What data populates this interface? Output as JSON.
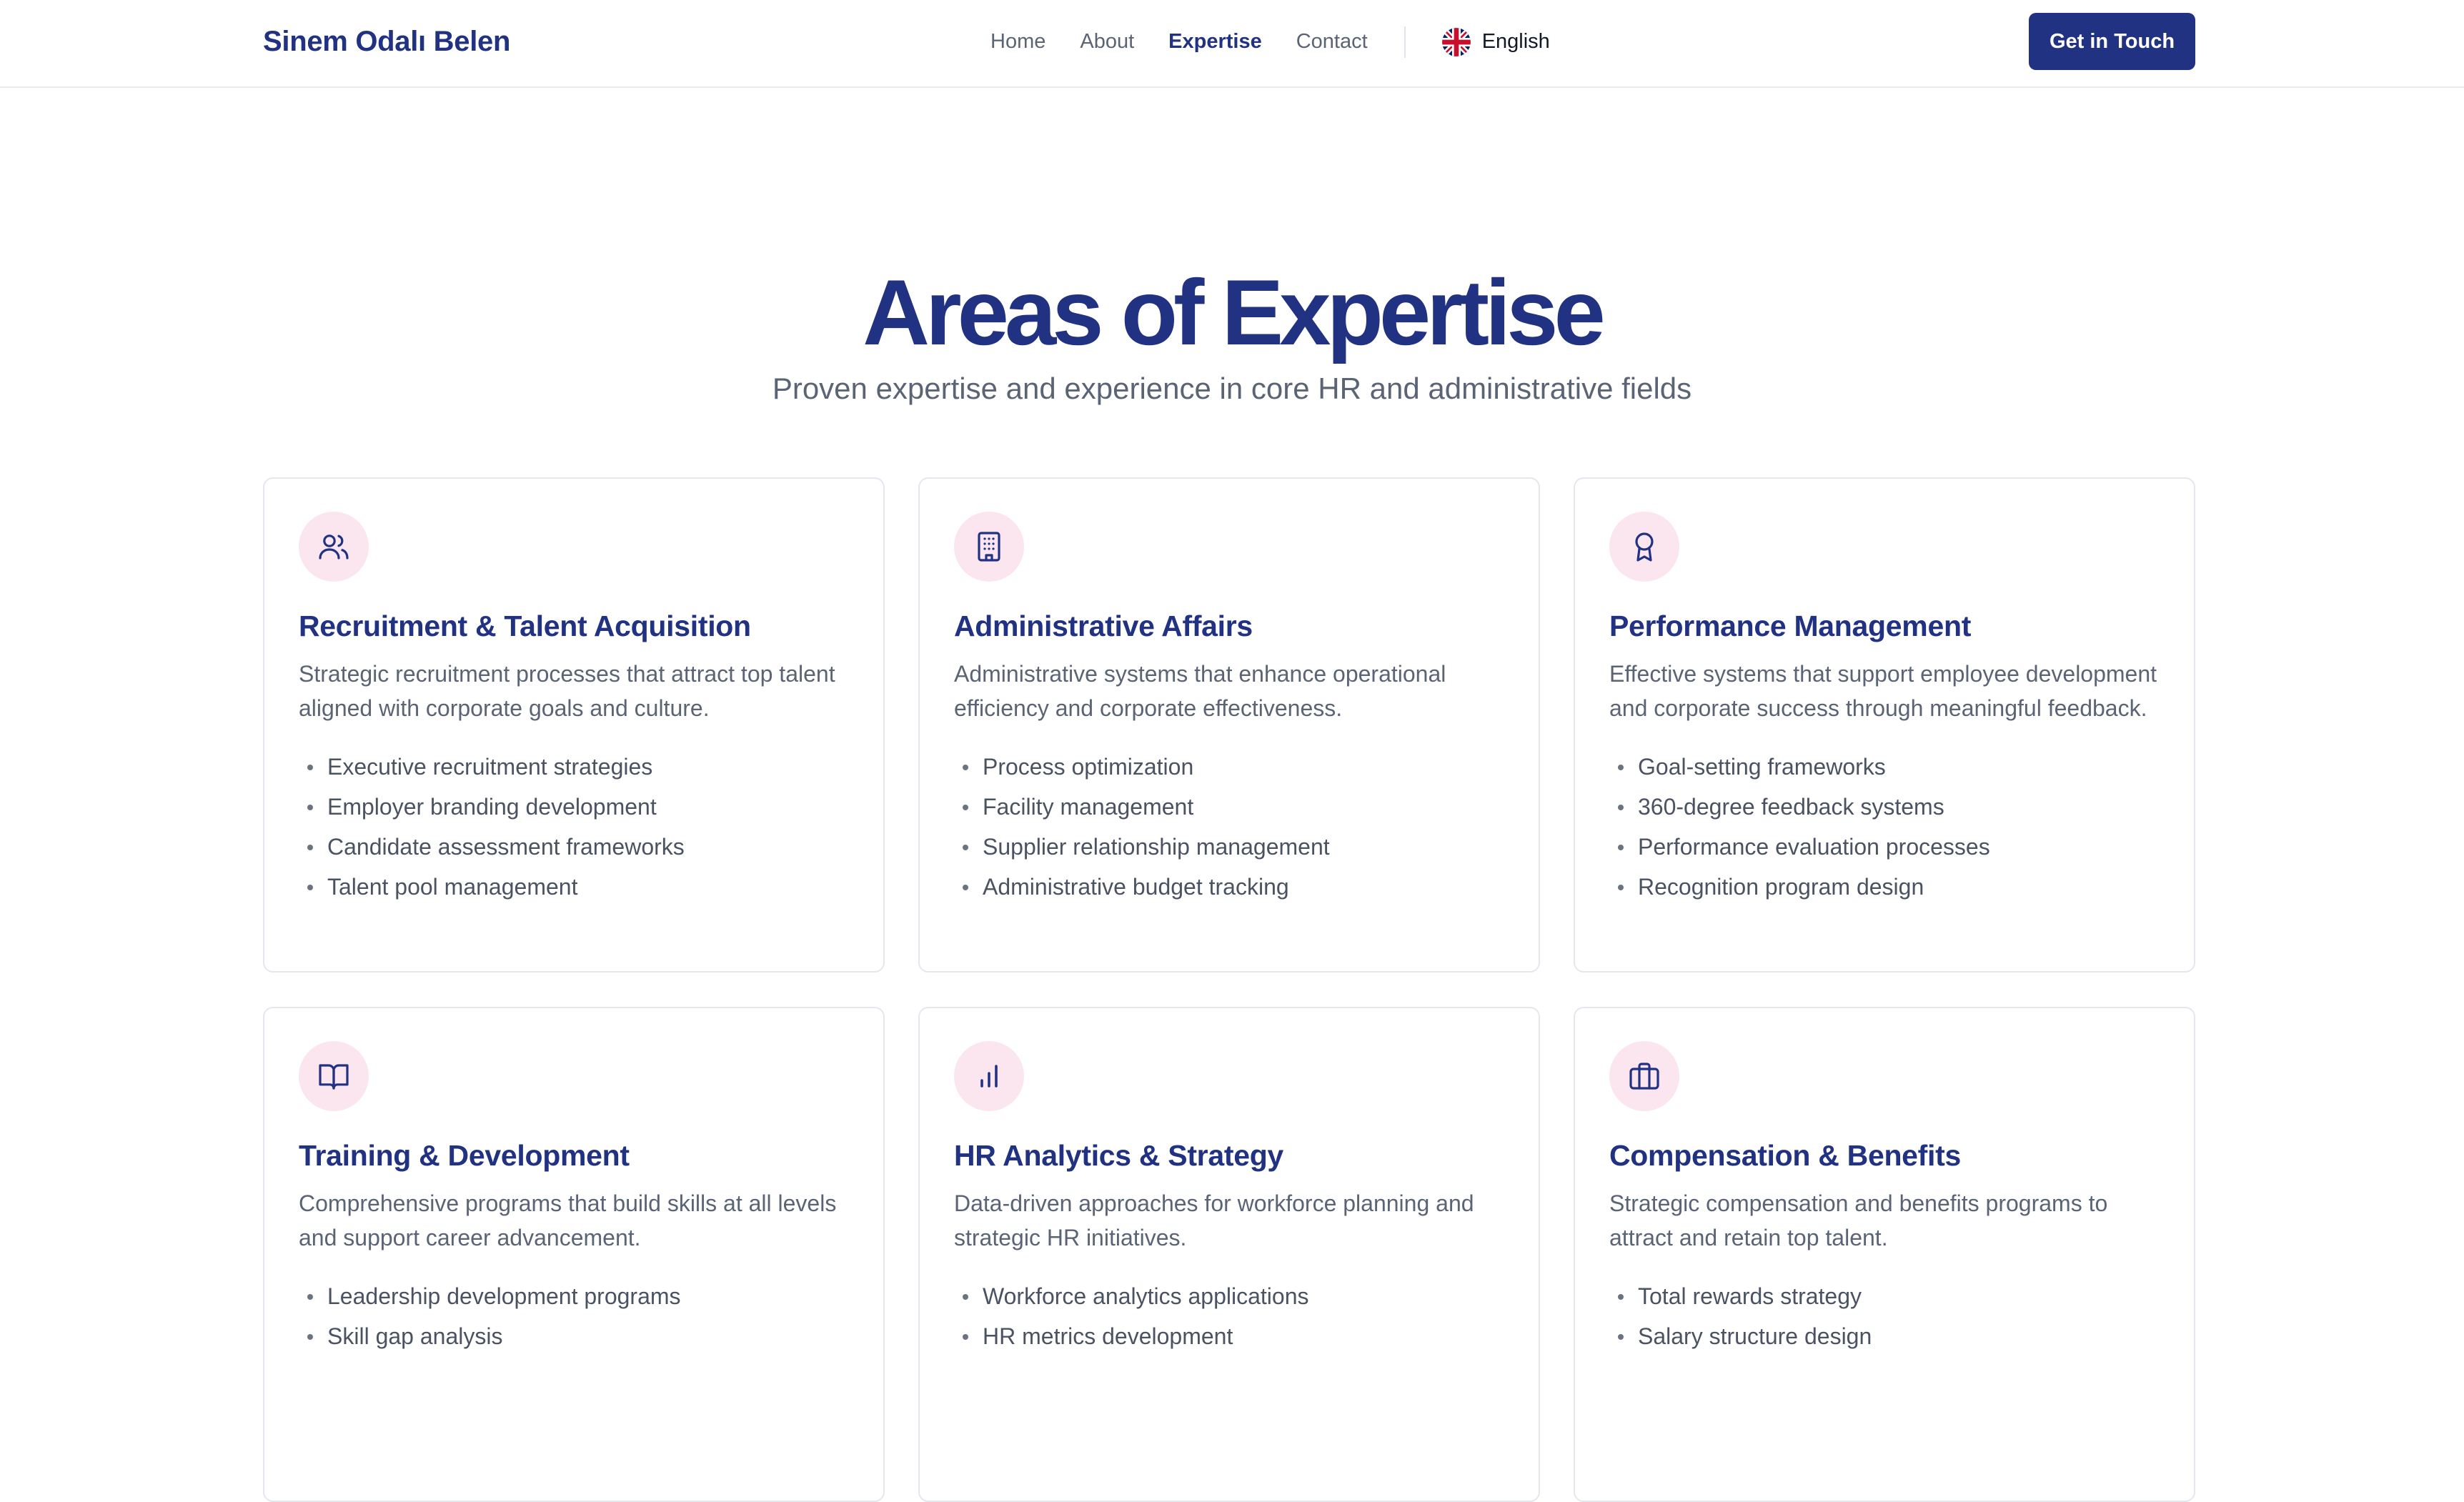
{
  "header": {
    "brand": "Sinem Odalı Belen",
    "nav": [
      "Home",
      "About",
      "Expertise",
      "Contact"
    ],
    "active_nav": "Expertise",
    "language": "English",
    "cta": "Get in Touch"
  },
  "hero": {
    "title": "Areas of Expertise",
    "subtitle": "Proven expertise and experience in core HR and administrative fields"
  },
  "cards": [
    {
      "icon": "users-icon",
      "title": "Recruitment & Talent Acquisition",
      "description": "Strategic recruitment processes that attract top talent aligned with corporate goals and culture.",
      "items": [
        "Executive recruitment strategies",
        "Employer branding development",
        "Candidate assessment frameworks",
        "Talent pool management"
      ]
    },
    {
      "icon": "building-icon",
      "title": "Administrative Affairs",
      "description": "Administrative systems that enhance operational efficiency and corporate effectiveness.",
      "items": [
        "Process optimization",
        "Facility management",
        "Supplier relationship management",
        "Administrative budget tracking"
      ]
    },
    {
      "icon": "award-icon",
      "title": "Performance Management",
      "description": "Effective systems that support employee development and corporate success through meaningful feedback.",
      "items": [
        "Goal-setting frameworks",
        "360-degree feedback systems",
        "Performance evaluation processes",
        "Recognition program design"
      ]
    },
    {
      "icon": "book-open-icon",
      "title": "Training & Development",
      "description": "Comprehensive programs that build skills at all levels and support career advancement.",
      "items": [
        "Leadership development programs",
        "Skill gap analysis"
      ]
    },
    {
      "icon": "bar-chart-icon",
      "title": "HR Analytics & Strategy",
      "description": "Data-driven approaches for workforce planning and strategic HR initiatives.",
      "items": [
        "Workforce analytics applications",
        "HR metrics development"
      ]
    },
    {
      "icon": "briefcase-icon",
      "title": "Compensation & Benefits",
      "description": "Strategic compensation and benefits programs to attract and retain top talent.",
      "items": [
        "Total rewards strategy",
        "Salary structure design"
      ]
    }
  ]
}
